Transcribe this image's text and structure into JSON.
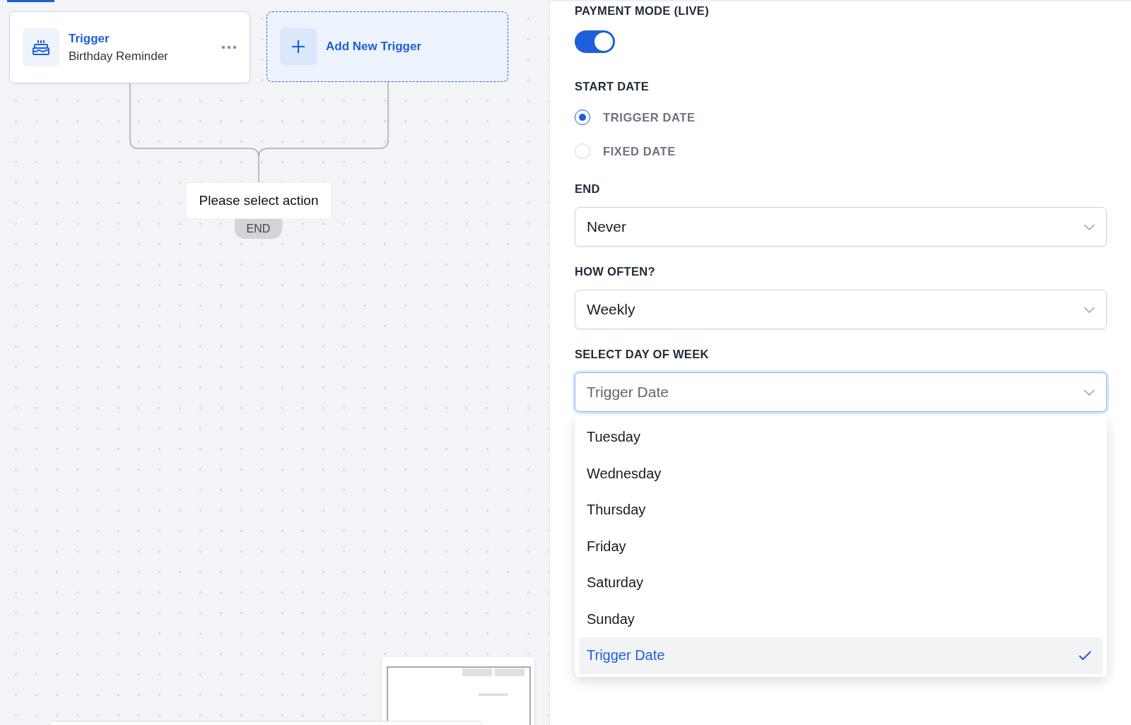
{
  "canvas": {
    "trigger_card": {
      "title": "Trigger",
      "subtitle": "Birthday Reminder"
    },
    "add_trigger": {
      "label": "Add New Trigger"
    },
    "action_node": {
      "label": "Please select action"
    },
    "end_node": {
      "label": "END"
    }
  },
  "panel": {
    "payment_mode": {
      "label": "PAYMENT MODE (LIVE)",
      "on": true
    },
    "start_date": {
      "label": "START DATE",
      "options": [
        {
          "label": "TRIGGER DATE",
          "selected": true
        },
        {
          "label": "FIXED DATE",
          "selected": false
        }
      ]
    },
    "end": {
      "label": "END",
      "value": "Never"
    },
    "how_often": {
      "label": "HOW OFTEN?",
      "value": "Weekly"
    },
    "day_of_week": {
      "label": "SELECT DAY OF WEEK",
      "value": "Trigger Date",
      "expanded": true,
      "options": [
        {
          "label": "Tuesday",
          "selected": false
        },
        {
          "label": "Wednesday",
          "selected": false
        },
        {
          "label": "Thursday",
          "selected": false
        },
        {
          "label": "Friday",
          "selected": false
        },
        {
          "label": "Saturday",
          "selected": false
        },
        {
          "label": "Sunday",
          "selected": false
        },
        {
          "label": "Trigger Date",
          "selected": true
        }
      ]
    }
  }
}
